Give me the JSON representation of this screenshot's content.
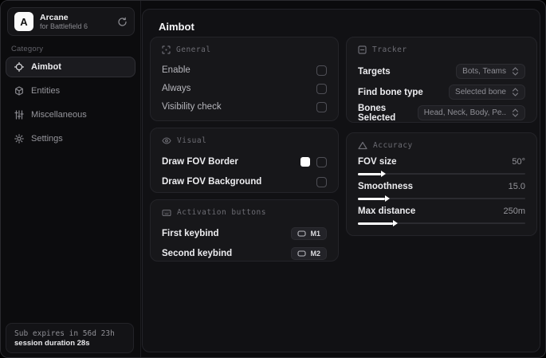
{
  "colors": {
    "fov_border_swatch": "#ffffff"
  },
  "app": {
    "name": "Arcane",
    "subtitle": "for Battlefield 6",
    "logo_letter": "A"
  },
  "sidebar": {
    "category_label": "Category",
    "items": [
      {
        "label": "Aimbot",
        "icon": "crosshair-icon",
        "active": true
      },
      {
        "label": "Entities",
        "icon": "cube-icon",
        "active": false
      },
      {
        "label": "Miscellaneous",
        "icon": "sliders-icon",
        "active": false
      },
      {
        "label": "Settings",
        "icon": "gear-icon",
        "active": false
      }
    ],
    "footer": {
      "sub_expires": "Sub expires in 56d 23h",
      "session_duration": "session duration 28s"
    }
  },
  "main": {
    "title": "Aimbot",
    "general": {
      "title": "General",
      "icon": "scan-icon",
      "rows": [
        {
          "label": "Enable",
          "checked": false
        },
        {
          "label": "Always",
          "checked": false
        },
        {
          "label": "Visibility check",
          "checked": false
        }
      ]
    },
    "visual": {
      "title": "Visual",
      "icon": "eye-icon",
      "rows": [
        {
          "label": "Draw FOV Border",
          "swatch_color": "#ffffff",
          "checked": false
        },
        {
          "label": "Draw FOV Background",
          "checked": false
        }
      ]
    },
    "activation": {
      "title": "Activation buttons",
      "icon": "keyboard-icon",
      "rows": [
        {
          "label": "First keybind",
          "key": "M1"
        },
        {
          "label": "Second keybind",
          "key": "M2"
        }
      ]
    },
    "tracker": {
      "title": "Tracker",
      "icon": "frame-minus-icon",
      "rows": [
        {
          "label": "Targets",
          "value": "Bots, Teams"
        },
        {
          "label": "Find bone type",
          "value": "Selected bone"
        },
        {
          "label": "Bones Selected",
          "value": "Head, Neck, Body, Pe.."
        }
      ]
    },
    "accuracy": {
      "title": "Accuracy",
      "icon": "triangle-icon",
      "sliders": [
        {
          "label": "FOV size",
          "value": "50°",
          "fill_percent": 14
        },
        {
          "label": "Smoothness",
          "value": "15.0",
          "fill_percent": 16
        },
        {
          "label": "Max distance",
          "value": "250m",
          "fill_percent": 21
        }
      ]
    }
  }
}
